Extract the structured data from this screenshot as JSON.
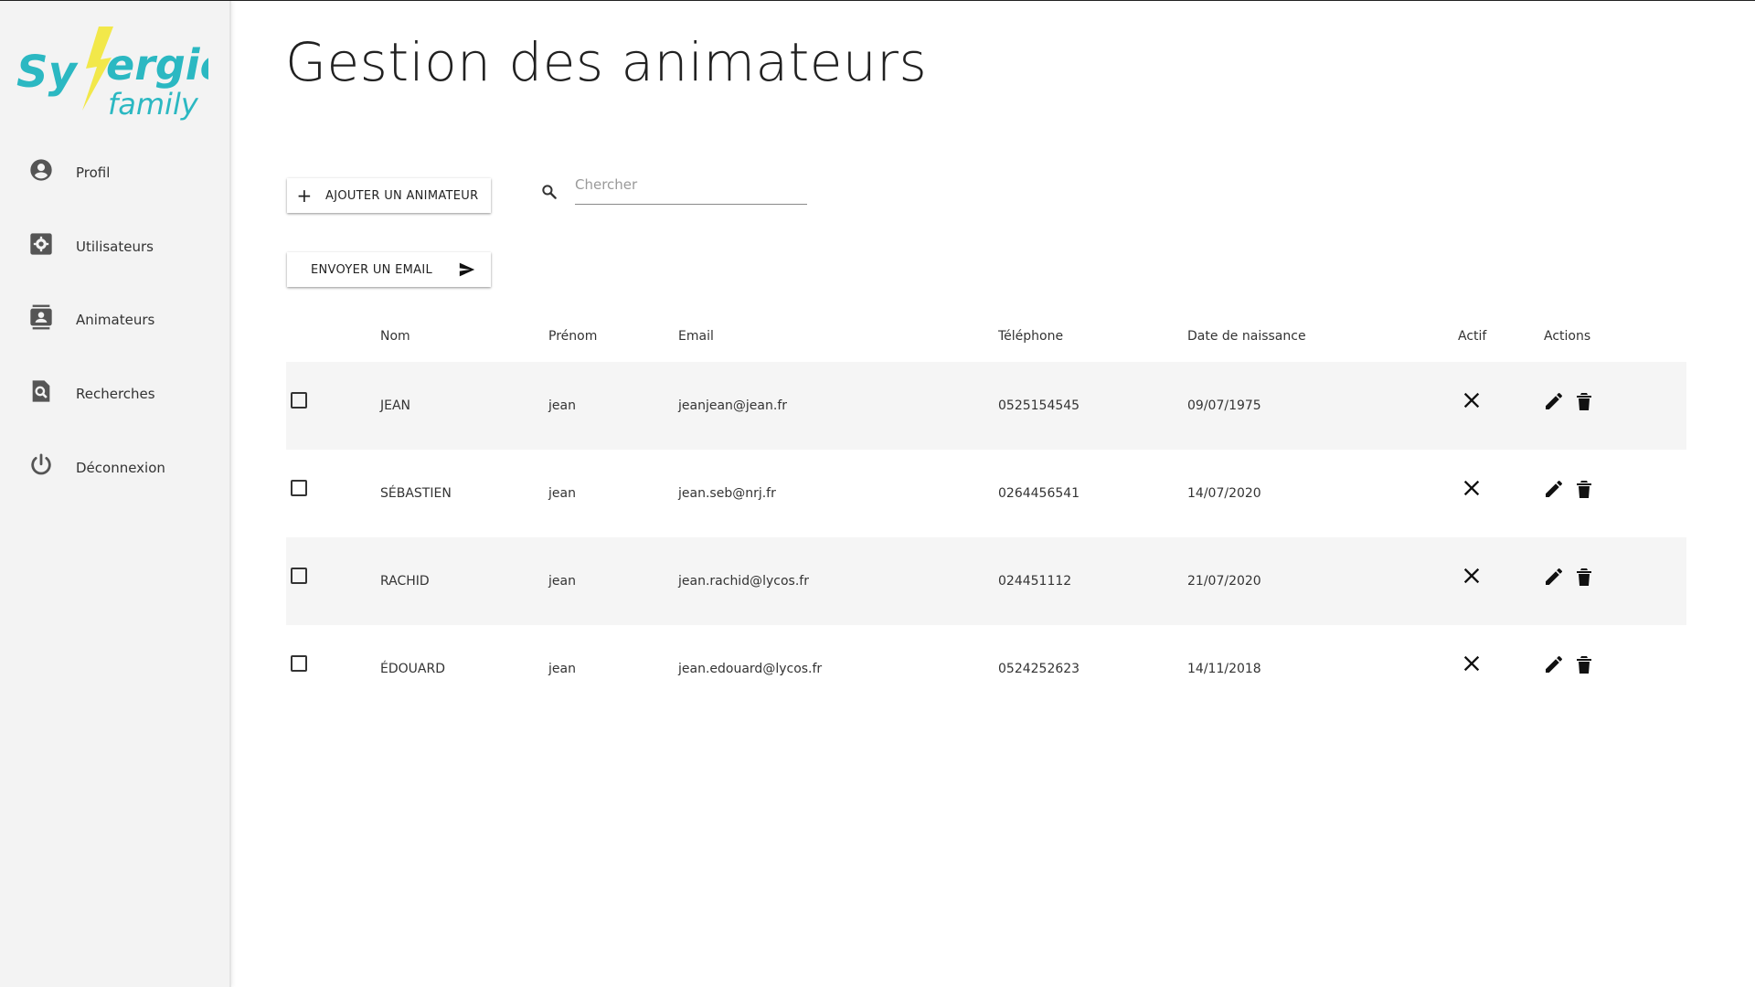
{
  "brand": {
    "logo_word_top": "Synergie",
    "logo_word_bottom": "family",
    "color_teal": "#2bb8c2",
    "color_yellow": "#f2e84a"
  },
  "sidebar": {
    "items": [
      {
        "label": "Profil",
        "icon": "account-circle-icon"
      },
      {
        "label": "Utilisateurs",
        "icon": "settings-box-icon"
      },
      {
        "label": "Animateurs",
        "icon": "contacts-icon"
      },
      {
        "label": "Recherches",
        "icon": "search-document-icon"
      },
      {
        "label": "Déconnexion",
        "icon": "power-icon"
      }
    ]
  },
  "page": {
    "title": "Gestion des animateurs"
  },
  "toolbar": {
    "add_label": "AJOUTER UN ANIMATEUR",
    "email_label": "ENVOYER UN EMAIL",
    "search_placeholder": "Chercher"
  },
  "table": {
    "headers": {
      "nom": "Nom",
      "prenom": "Prénom",
      "email": "Email",
      "tel": "Téléphone",
      "date": "Date de naissance",
      "actif": "Actif",
      "actions": "Actions"
    },
    "rows": [
      {
        "nom": "JEAN",
        "prenom": "jean",
        "email": "jeanjean@jean.fr",
        "tel": "0525154545",
        "date": "09/07/1975",
        "actif": false
      },
      {
        "nom": "SÉBASTIEN",
        "prenom": "jean",
        "email": "jean.seb@nrj.fr",
        "tel": "0264456541",
        "date": "14/07/2020",
        "actif": false
      },
      {
        "nom": "RACHID",
        "prenom": "jean",
        "email": "jean.rachid@lycos.fr",
        "tel": "024451112",
        "date": "21/07/2020",
        "actif": false
      },
      {
        "nom": "ÉDOUARD",
        "prenom": "jean",
        "email": "jean.edouard@lycos.fr",
        "tel": "0524252623",
        "date": "14/11/2018",
        "actif": false
      }
    ]
  }
}
